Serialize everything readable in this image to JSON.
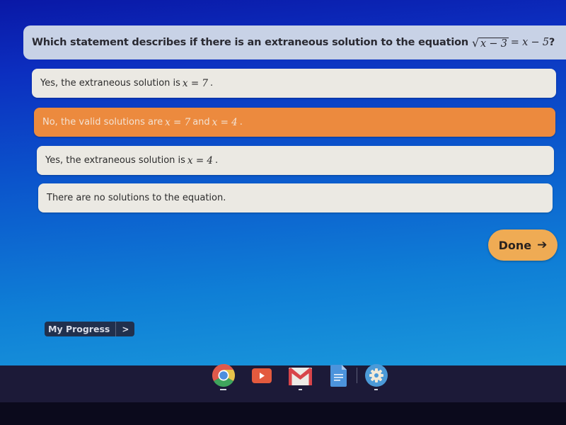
{
  "question": {
    "text": "Which statement describes if there is an extraneous solution to the equation",
    "equation": {
      "radicand": "x − 3",
      "rhs": "= x − 5",
      "end": "?"
    }
  },
  "options": [
    {
      "prefix": "Yes, the extraneous solution is",
      "math": "x = 7",
      "suffix": ".",
      "selected": false
    },
    {
      "prefix": "No, the valid solutions are",
      "math": "x = 7",
      "mid": "and",
      "math2": "x = 4",
      "suffix": ".",
      "selected": true
    },
    {
      "prefix": "Yes, the extraneous solution is",
      "math": "x = 4",
      "suffix": ".",
      "selected": false
    },
    {
      "prefix": "There are no solutions to the equation.",
      "selected": false
    }
  ],
  "done_button": {
    "label": "Done",
    "icon": "arrow-right-icon"
  },
  "progress_button": {
    "label": "My Progress",
    "chevron": ">"
  },
  "shelf": {
    "apps": [
      {
        "name": "Chrome",
        "icon": "chrome-icon",
        "running": true
      },
      {
        "name": "YouTube",
        "icon": "youtube-icon",
        "running": false
      },
      {
        "name": "Gmail",
        "icon": "gmail-icon",
        "running": true
      },
      {
        "name": "Docs",
        "icon": "docs-icon",
        "running": false
      },
      {
        "name": "Settings",
        "icon": "settings-icon",
        "running": true
      }
    ]
  },
  "colors": {
    "selected_option": "#ec8a3e",
    "done_button": "#efab54",
    "option_bg": "#ebe9e3"
  }
}
